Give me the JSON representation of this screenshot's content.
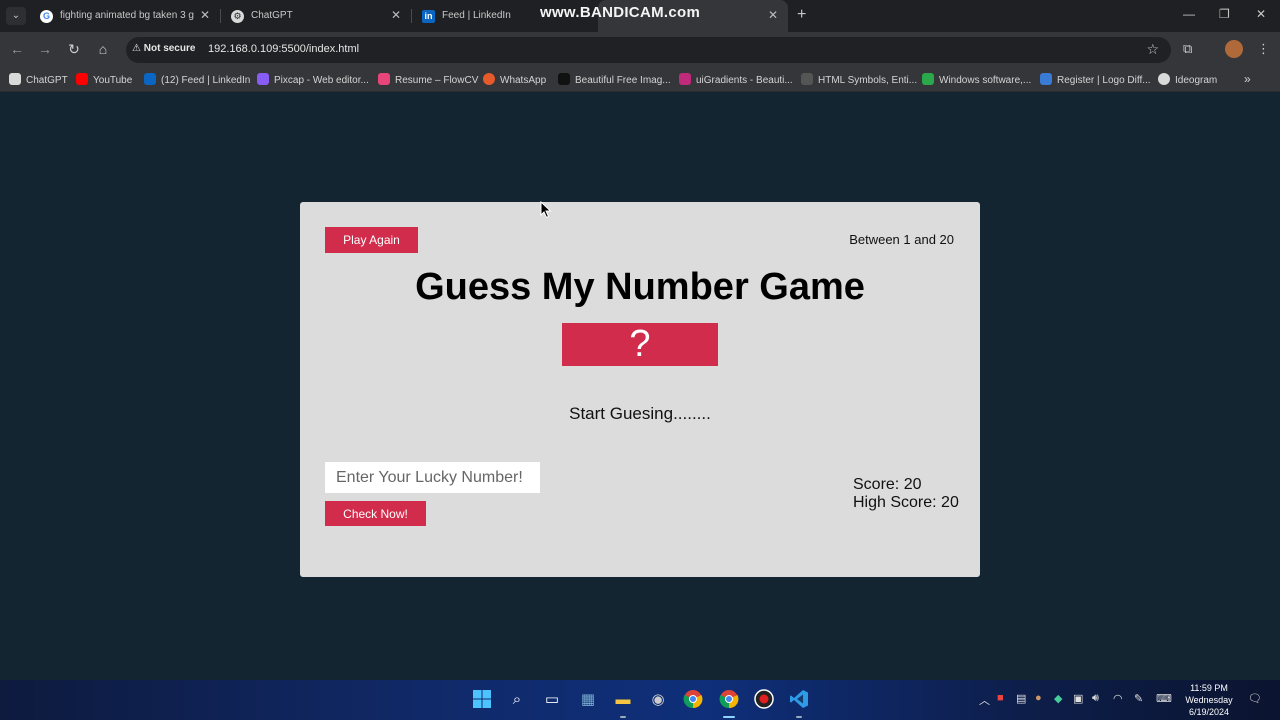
{
  "browser": {
    "tabs": [
      {
        "title": "fighting animated bg taken 3 g",
        "icon": "google-icon",
        "active": false
      },
      {
        "title": "ChatGPT",
        "icon": "chatgpt-icon",
        "active": false
      },
      {
        "title": "Feed | LinkedIn",
        "icon": "linkedin-icon",
        "active": false
      },
      {
        "title": "",
        "icon": "",
        "active": true
      }
    ],
    "watermark": "www.BANDICAM.com",
    "security_label": "Not secure",
    "url": "192.168.0.109:5500/index.html",
    "bookmarks": [
      {
        "label": "ChatGPT",
        "color": "#d9d9d9"
      },
      {
        "label": "YouTube",
        "color": "#ff0000"
      },
      {
        "label": "(12) Feed | LinkedIn",
        "color": "#0a66c2"
      },
      {
        "label": "Pixcap - Web editor...",
        "color": "#8a5cf6"
      },
      {
        "label": "Resume – FlowCV",
        "color": "#e8457a"
      },
      {
        "label": "WhatsApp",
        "color": "#e65a2b"
      },
      {
        "label": "Beautiful Free Imag...",
        "color": "#111111"
      },
      {
        "label": "uiGradients - Beauti...",
        "color": "#c02a7a"
      },
      {
        "label": "HTML Symbols, Enti...",
        "color": "#555555"
      },
      {
        "label": "Windows software,...",
        "color": "#2aa84a"
      },
      {
        "label": "Register | Logo Diff...",
        "color": "#3a7bd5"
      },
      {
        "label": "Ideogram",
        "color": "#d9d9d9"
      }
    ]
  },
  "game": {
    "play_again_label": "Play Again",
    "range_text": "Between 1 and 20",
    "title": "Guess My Number Game",
    "secret": "?",
    "message": "Start Guesing........",
    "input_placeholder": "Enter Your Lucky Number!",
    "check_label": "Check Now!",
    "score_text": "Score: 20",
    "highscore_text": "High Score: 20",
    "accent_color": "#d12c4b"
  },
  "taskbar": {
    "time": "11:59 PM",
    "day": "Wednesday",
    "date": "6/19/2024"
  }
}
